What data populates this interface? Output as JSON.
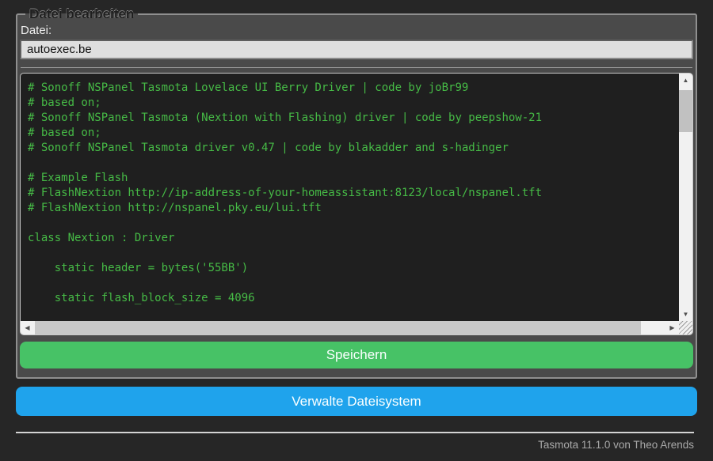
{
  "editor": {
    "legend": "Datei bearbeiten",
    "file_label": "Datei:",
    "file_value": "autoexec.be",
    "save_button": "Speichern",
    "code_lines": [
      "# Sonoff NSPanel Tasmota Lovelace UI Berry Driver | code by joBr99",
      "# based on;",
      "# Sonoff NSPanel Tasmota (Nextion with Flashing) driver | code by peepshow-21",
      "# based on;",
      "# Sonoff NSPanel Tasmota driver v0.47 | code by blakadder and s-hadinger",
      "",
      "# Example Flash",
      "# FlashNextion http://ip-address-of-your-homeassistant:8123/local/nspanel.tft",
      "# FlashNextion http://nspanel.pky.eu/lui.tft",
      "",
      "class Nextion : Driver",
      "",
      "    static header = bytes('55BB')",
      "",
      "    static flash_block_size = 4096"
    ]
  },
  "nav": {
    "manage_fs_button": "Verwalte Dateisystem"
  },
  "footer": {
    "version_text": "Tasmota 11.1.0 von Theo Arends"
  },
  "icons": {
    "scroll_up": "▲",
    "scroll_down": "▼",
    "scroll_left": "◀",
    "scroll_right": "▶"
  },
  "colors": {
    "page_background": "#262626",
    "form_background": "#4a4a4a",
    "save_green": "#47c266",
    "manage_blue": "#1fa3ec",
    "code_text_green": "#46bb46",
    "code_background": "#1f1f1f",
    "input_background": "#dfdfdf"
  }
}
